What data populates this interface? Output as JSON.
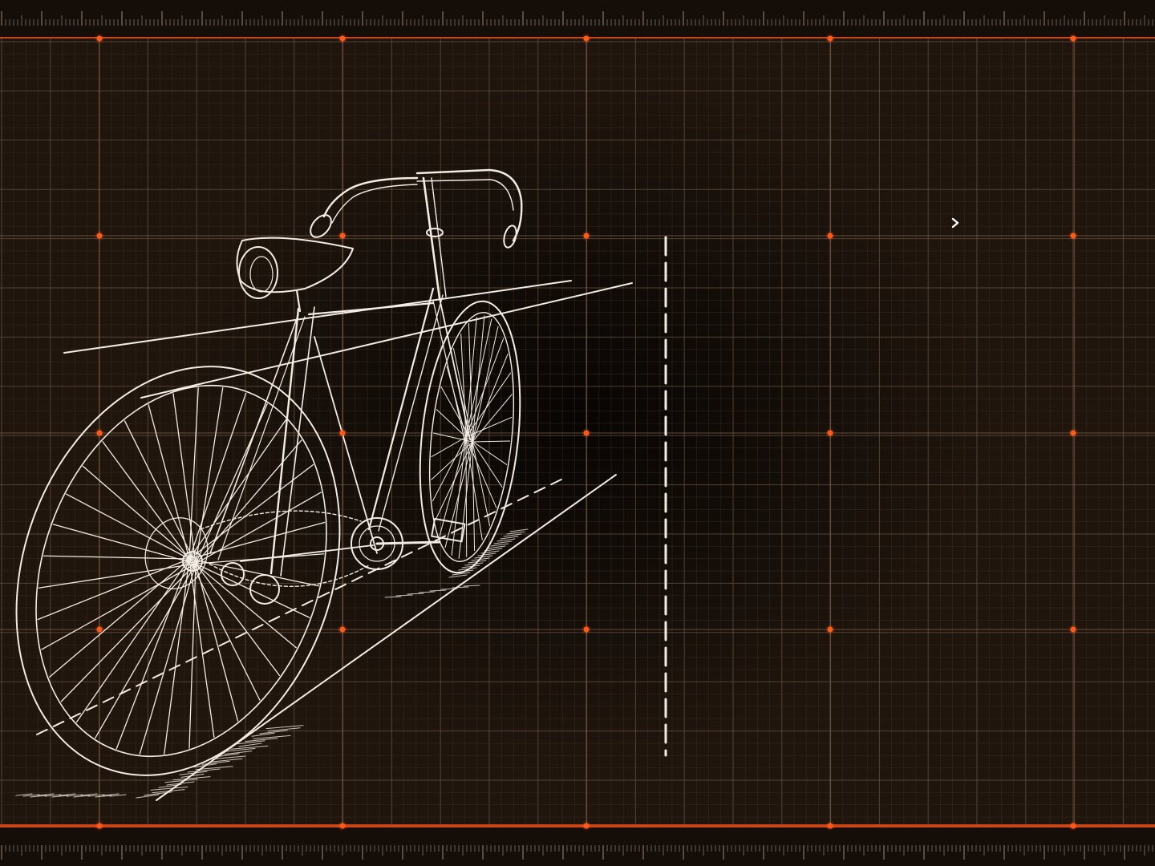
{
  "scene": {
    "subject": "bicycle-blueprint-wireframe"
  },
  "theme": {
    "background": "#1f150d",
    "accent": "#c9461c",
    "marker": "#ff5a1a",
    "line": "#f2ece4",
    "grid_minor": "#3a2b1f",
    "grid_major": "#6a5645"
  },
  "icons": {
    "cursor": "chevron-right-icon"
  }
}
